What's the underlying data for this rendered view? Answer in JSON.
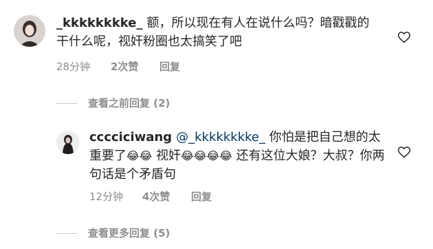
{
  "comment1": {
    "username": "_kkkkkkkke_",
    "text": "额，所以现在有人在说什么吗？暗戳戳的干什么呢，视奸粉圈也太搞笑了吧",
    "time": "28分钟",
    "likes": "2次赞",
    "reply": "回复"
  },
  "view_previous_replies": "查看之前回复 (2)",
  "reply1": {
    "username": "cccciciwang",
    "mention": "@_kkkkkkkke_",
    "text1": "你怕是把自己想的太重要了",
    "emojis1": "😂😂",
    "text2": "视奸",
    "emojis2": "😂😂😂😂",
    "text3": "还有这位大娘？大叔？你两句话是个矛盾句",
    "time": "12分钟",
    "likes": "4次赞",
    "reply": "回复"
  },
  "view_more_replies": "查看更多回复 (5)",
  "colors": {
    "text": "#262626",
    "meta": "#8e8e8e",
    "mention": "#00376b",
    "divider": "#c7c7c7"
  },
  "icons": {
    "like": "heart-outline-icon"
  }
}
